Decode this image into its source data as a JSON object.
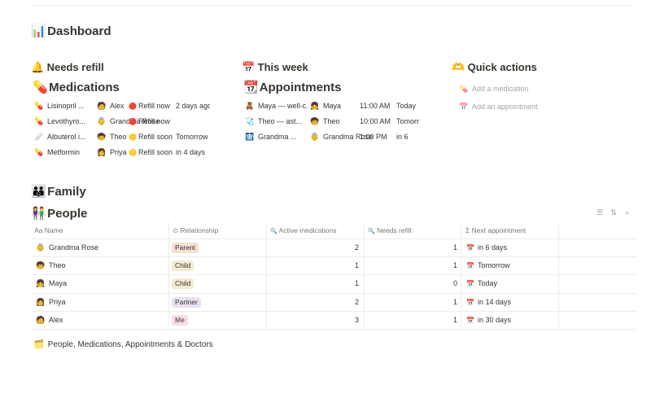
{
  "page": {
    "title": "Dashboard",
    "title_icon": "📊"
  },
  "needs_refill": {
    "heading": "Needs refill",
    "heading_icon": "🔔",
    "sub_heading": "Medications",
    "sub_icon": "💊",
    "rows": [
      {
        "icon": "💊",
        "name": "Lisinopril ...",
        "person_icon": "🧑",
        "person": "Alex",
        "status_icon": "🔴",
        "status": "Refill now",
        "when": "2 days ago"
      },
      {
        "icon": "💊",
        "name": "Levothyro...",
        "person_icon": "👵",
        "person": "Grandma Rose",
        "status_icon": "🔴",
        "status": "Refill now",
        "when": ""
      },
      {
        "icon": "🩹",
        "name": "Albuterol i...",
        "person_icon": "🧒",
        "person": "Theo",
        "status_icon": "🟡",
        "status": "Refill soon",
        "when": "Tomorrow"
      },
      {
        "icon": "💊",
        "name": "Metformin",
        "person_icon": "👩",
        "person": "Priya",
        "status_icon": "🟡",
        "status": "Refill soon",
        "when": "in 4 days"
      }
    ]
  },
  "this_week": {
    "heading": "This week",
    "heading_icon": "📅",
    "sub_heading": "Appointments",
    "sub_icon": "📆",
    "rows": [
      {
        "icon": "🧸",
        "name": "Maya — well-c...",
        "person_icon": "👧",
        "person": "Maya",
        "time": "11:00 AM",
        "when": "Today"
      },
      {
        "icon": "🩺",
        "name": "Theo — ast...",
        "person_icon": "🧒",
        "person": "Theo",
        "time": "10:00 AM",
        "when": "Tomorrow"
      },
      {
        "icon": "🩻",
        "name": "Grandma ...",
        "person_icon": "👵",
        "person": "Grandma Rose",
        "time": "1:00 PM",
        "when": "in 6"
      }
    ]
  },
  "quick_actions": {
    "heading": "Quick actions",
    "heading_icon": "🫶",
    "items": [
      {
        "icon": "💊",
        "label": "Add a medication"
      },
      {
        "icon": "📅",
        "label": "Add an appointment"
      }
    ]
  },
  "family": {
    "heading": "Family",
    "heading_icon": "👪",
    "sub_heading": "People",
    "sub_icon": "👫",
    "columns": [
      {
        "icon": "Aa",
        "label": "Name"
      },
      {
        "icon": "⊙",
        "label": "Relationship"
      },
      {
        "icon": "🔍",
        "label": "Active medications"
      },
      {
        "icon": "🔍",
        "label": "Needs refill"
      },
      {
        "icon": "Σ",
        "label": "Next appointment"
      }
    ],
    "rows": [
      {
        "icon": "👵",
        "name": "Grandma Rose",
        "relationship": "Parent",
        "rel_color": "#f5e0d3",
        "active": "2",
        "refill": "1",
        "next_icon": "📅",
        "next": "in 6 days"
      },
      {
        "icon": "🧒",
        "name": "Theo",
        "relationship": "Child",
        "rel_color": "#f3ead1",
        "active": "1",
        "refill": "1",
        "next_icon": "📅",
        "next": "Tomorrow"
      },
      {
        "icon": "👧",
        "name": "Maya",
        "relationship": "Child",
        "rel_color": "#f3ead1",
        "active": "1",
        "refill": "0",
        "next_icon": "📅",
        "next": "Today"
      },
      {
        "icon": "👩",
        "name": "Priya",
        "relationship": "Partner",
        "rel_color": "#eadff2",
        "active": "2",
        "refill": "1",
        "next_icon": "📅",
        "next": "in 14 days"
      },
      {
        "icon": "🧑",
        "name": "Alex",
        "relationship": "Me",
        "rel_color": "#f8dde7",
        "active": "3",
        "refill": "1",
        "next_icon": "📅",
        "next": "in 30 days"
      }
    ]
  },
  "footer": {
    "icon": "🗂️",
    "label": "People, Medications, Appointments & Doctors"
  }
}
